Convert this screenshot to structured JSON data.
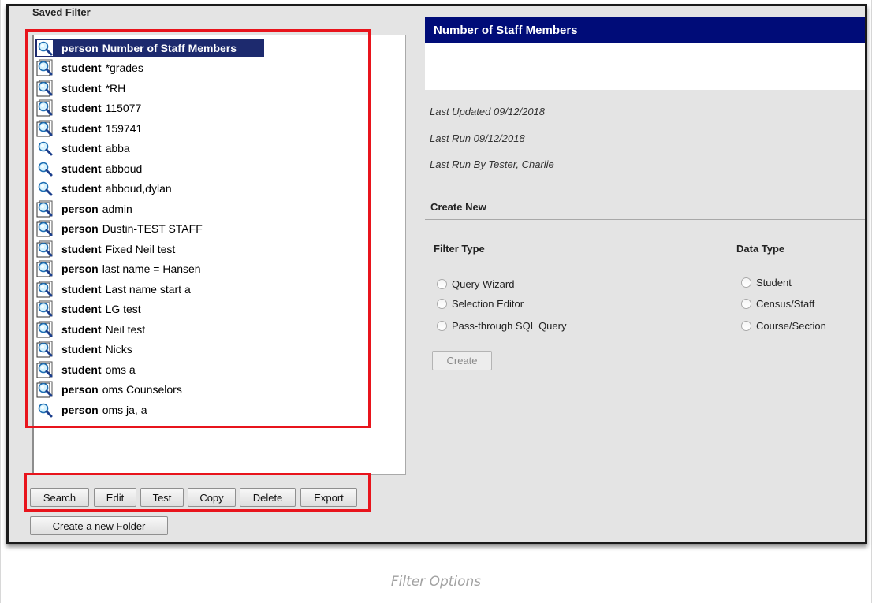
{
  "saved_filter": {
    "title": "Saved Filter",
    "items": [
      {
        "kind": "person",
        "name": "Number of Staff Members",
        "selected": true,
        "icon": "query-wizard-icon"
      },
      {
        "kind": "student",
        "name": "*grades",
        "icon": "selection-editor-icon"
      },
      {
        "kind": "student",
        "name": "*RH",
        "icon": "selection-editor-icon"
      },
      {
        "kind": "student",
        "name": "115077",
        "icon": "selection-editor-icon"
      },
      {
        "kind": "student",
        "name": "159741",
        "icon": "selection-editor-icon"
      },
      {
        "kind": "student",
        "name": "abba",
        "icon": "query-wizard-icon"
      },
      {
        "kind": "student",
        "name": "abboud",
        "icon": "query-wizard-icon"
      },
      {
        "kind": "student",
        "name": "abboud,dylan",
        "icon": "query-wizard-icon"
      },
      {
        "kind": "person",
        "name": "admin",
        "icon": "selection-editor-icon"
      },
      {
        "kind": "person",
        "name": "Dustin-TEST STAFF",
        "icon": "selection-editor-icon"
      },
      {
        "kind": "student",
        "name": "Fixed Neil test",
        "icon": "selection-editor-icon"
      },
      {
        "kind": "person",
        "name": "last name = Hansen",
        "icon": "selection-editor-icon"
      },
      {
        "kind": "student",
        "name": "Last name start a",
        "icon": "selection-editor-icon"
      },
      {
        "kind": "student",
        "name": "LG test",
        "icon": "selection-editor-icon"
      },
      {
        "kind": "student",
        "name": "Neil test",
        "icon": "selection-editor-icon"
      },
      {
        "kind": "student",
        "name": "Nicks",
        "icon": "selection-editor-icon"
      },
      {
        "kind": "student",
        "name": "oms a",
        "icon": "selection-editor-icon"
      },
      {
        "kind": "person",
        "name": "oms Counselors",
        "icon": "selection-editor-icon"
      },
      {
        "kind": "person",
        "name": "oms ja, a",
        "icon": "query-wizard-icon"
      }
    ]
  },
  "toolbar": {
    "search": "Search",
    "edit": "Edit",
    "test": "Test",
    "copy": "Copy",
    "delete": "Delete",
    "export": "Export",
    "create_folder": "Create a new Folder"
  },
  "detail": {
    "title": "Number of Staff Members",
    "last_updated": "Last Updated 09/12/2018",
    "last_run": "Last Run 09/12/2018",
    "last_run_by": "Last Run By Tester, Charlie"
  },
  "create_new": {
    "title": "Create New",
    "filter_type": {
      "title": "Filter Type",
      "options": [
        "Query Wizard",
        "Selection Editor",
        "Pass-through SQL Query"
      ]
    },
    "data_type": {
      "title": "Data Type",
      "options": [
        "Student",
        "Census/Staff",
        "Course/Section"
      ]
    },
    "create_button": "Create"
  },
  "caption": "Filter Options",
  "colors": {
    "selection": "#1d2a6e",
    "header": "#000c78",
    "highlight": "#e8141c"
  }
}
